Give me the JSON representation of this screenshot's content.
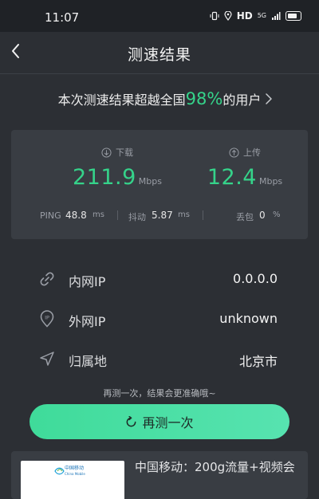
{
  "status_bar": {
    "time": "11:07",
    "network_label": "HD",
    "signal_label": "5G"
  },
  "nav": {
    "title": "测速结果"
  },
  "summary": {
    "prefix": "本次测速结果超越全国",
    "percent": "98%",
    "suffix": "的用户"
  },
  "speeds": {
    "download": {
      "label": "下载",
      "value": "211.9",
      "unit": "Mbps"
    },
    "upload": {
      "label": "上传",
      "value": "12.4",
      "unit": "Mbps"
    }
  },
  "sub_metrics": {
    "ping": {
      "label": "PING",
      "value": "48.8",
      "unit": "ms"
    },
    "jitter": {
      "label": "抖动",
      "value": "5.87",
      "unit": "ms"
    },
    "loss": {
      "label": "丢包",
      "value": "0",
      "unit": "%"
    }
  },
  "info": [
    {
      "label": "内网IP",
      "value": "0.0.0.0",
      "icon": "link-icon"
    },
    {
      "label": "外网IP",
      "value": "unknown",
      "icon": "ip-pin-icon"
    },
    {
      "label": "归属地",
      "value": "北京市",
      "icon": "location-arrow-icon"
    }
  ],
  "hint": "再测一次，结果会更准确哦~",
  "retest_button": {
    "label": "再测一次"
  },
  "ad": {
    "logo_text": "中国移动",
    "logo_subtext": "China Mobile",
    "text": "中国移动：200g流量+视频会"
  },
  "colors": {
    "accent": "#35d38a",
    "background": "#2c2f34",
    "card": "#393d43"
  }
}
